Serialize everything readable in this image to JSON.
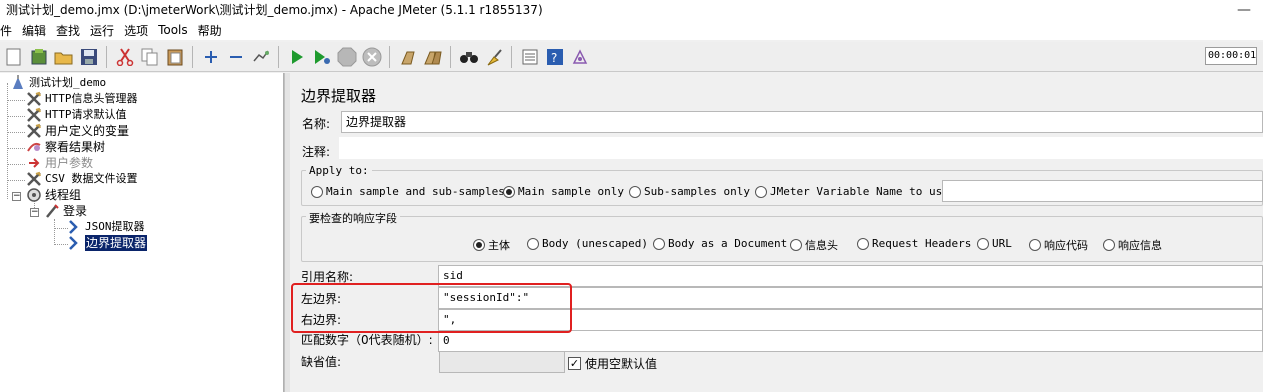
{
  "window": {
    "title": "测试计划_demo.jmx (D:\\jmeterWork\\测试计划_demo.jmx) - Apache JMeter (5.1.1 r1855137)",
    "minimize": "—"
  },
  "menu": [
    "件",
    "编辑",
    "查找",
    "运行",
    "选项",
    "Tools",
    "帮助"
  ],
  "toolbar": {
    "timer": "00:00:01",
    "icons": [
      "new-icon",
      "templates-icon",
      "open-icon",
      "save-icon",
      "cut-icon",
      "copy-icon",
      "paste-icon",
      "expand-icon",
      "collapse-icon",
      "toggle-icon",
      "start-icon",
      "start-no-pause-icon",
      "stop-icon",
      "shutdown-icon",
      "clear-icon",
      "clear-all-icon",
      "search-icon",
      "reset-search-icon",
      "function-helper-icon",
      "help-icon",
      "log-viewer-icon"
    ]
  },
  "tree": {
    "root": "测试计划_demo",
    "items": {
      "header_manager": "HTTP信息头管理器",
      "request_defaults": "HTTP请求默认值",
      "user_vars": "用户定义的变量",
      "view_results": "察看结果树",
      "user_params": "用户参数",
      "csv": "CSV 数据文件设置",
      "thread_group": "线程组",
      "login": "登录",
      "json_extractor": "JSON提取器",
      "boundary_extractor": "边界提取器"
    }
  },
  "panel": {
    "title": "边界提取器",
    "name_label": "名称:",
    "name_value": "边界提取器",
    "comment_label": "注释:",
    "apply_to": {
      "title": "Apply to:",
      "options": [
        "Main sample and sub-samples",
        "Main sample only",
        "Sub-samples only",
        "JMeter Variable Name to use"
      ],
      "selected": 1
    },
    "field_check": {
      "title": "要检查的响应字段",
      "options": [
        "主体",
        "Body (unescaped)",
        "Body as a Document",
        "信息头",
        "Request Headers",
        "URL",
        "响应代码",
        "响应信息"
      ],
      "selected": 0
    },
    "ref_name_label": "引用名称:",
    "ref_name_value": "sid",
    "left_label": "左边界:",
    "left_value": "\"sessionId\":\"",
    "right_label": "右边界:",
    "right_value": "\",",
    "match_label": "匹配数字（0代表随机）:",
    "match_value": "0",
    "default_label": "缺省值:",
    "default_value": "",
    "empty_default_label": "使用空默认值",
    "empty_default_checked": true
  },
  "colors": {
    "highlight": "#e02020",
    "selection": "#0a246a"
  }
}
